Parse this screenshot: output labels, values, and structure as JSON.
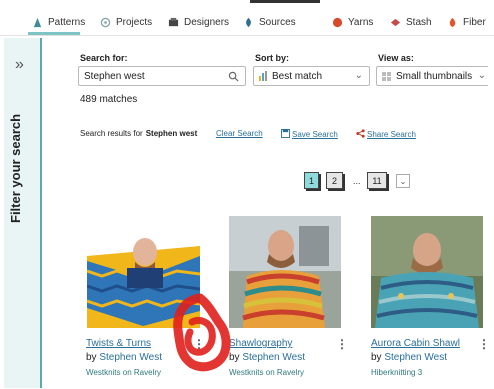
{
  "nav": {
    "items": [
      {
        "label": "Patterns",
        "icon": "patterns-icon",
        "active": true
      },
      {
        "label": "Projects",
        "icon": "projects-icon"
      },
      {
        "label": "Designers",
        "icon": "designers-icon"
      },
      {
        "label": "Sources",
        "icon": "sources-icon"
      },
      {
        "label": "Yarns",
        "icon": "yarns-icon"
      },
      {
        "label": "Stash",
        "icon": "stash-icon"
      },
      {
        "label": "Fiber",
        "icon": "fiber-icon"
      }
    ]
  },
  "sidebar": {
    "toggle_glyph": "»",
    "label": "Filter your search"
  },
  "search": {
    "label": "Search for:",
    "value": "Stephen west",
    "matches": "489 matches"
  },
  "sort": {
    "label": "Sort by:",
    "value": "Best match"
  },
  "view": {
    "label": "View as:",
    "value": "Small thumbnails"
  },
  "results": {
    "prefix": "Search results for",
    "term": "Stephen west",
    "clear_label": "Clear Search",
    "save_label": "Save Search",
    "share_label": "Share Search"
  },
  "pagination": {
    "pages": [
      "1",
      "2",
      "11"
    ],
    "current": "1",
    "ellipsis": "..."
  },
  "cards": [
    {
      "title": "Twists & Turns",
      "by_prefix": "by",
      "designer": "Stephen West",
      "source": "Westknits on Ravelry",
      "more": "⋮"
    },
    {
      "title": "Shawlography",
      "by_prefix": "by",
      "designer": "Stephen West",
      "source": "Westknits on Ravelry",
      "more": "⋮"
    },
    {
      "title": "Aurora Cabin Shawl",
      "by_prefix": "by",
      "designer": "Stephen West",
      "source": "Hiberknitting 3",
      "more": "⋮"
    }
  ],
  "colors": {
    "accent_teal": "#5aa9ad",
    "sidebar_bg": "#e9f4f5",
    "link_blue": "#2a6f9a",
    "page_active": "#8fdada",
    "annotation_red": "#e0201c"
  }
}
